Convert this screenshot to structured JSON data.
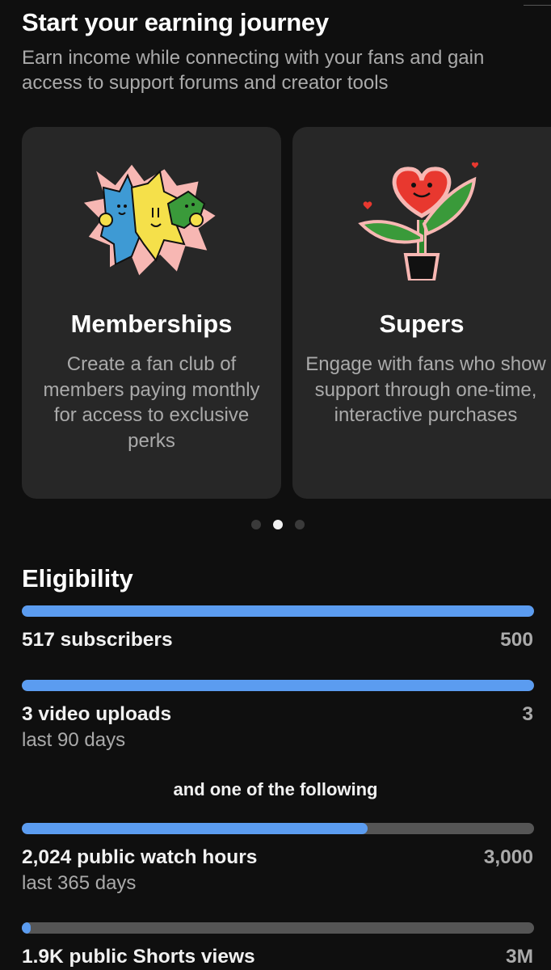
{
  "header": {
    "title": "Start your earning journey",
    "subtitle": "Earn income while connecting with your fans and gain access to support forums and creator tools"
  },
  "carousel": {
    "cards": [
      {
        "icon": "memberships-illustration-icon",
        "title": "Memberships",
        "description": "Create a fan club of members paying monthly for access to exclusive perks"
      },
      {
        "icon": "supers-flower-illustration-icon",
        "title": "Supers",
        "description": "Engage with fans who show support through one-time, interactive purchases"
      }
    ],
    "page_count": 3,
    "active_page": 2
  },
  "eligibility": {
    "title": "Eligibility",
    "connector": "and one of the following",
    "requirements": [
      {
        "label": "517 subscribers",
        "target": "500",
        "sub": "",
        "progress": 1.0
      },
      {
        "label": "3 video uploads",
        "target": "3",
        "sub": "last 90 days",
        "progress": 1.0
      },
      {
        "label": "2,024 public watch hours",
        "target": "3,000",
        "sub": "last 365 days",
        "progress": 0.675
      },
      {
        "label": "1.9K public Shorts views",
        "target": "3M",
        "sub": "",
        "progress": 0.012
      }
    ]
  },
  "colors": {
    "background": "#0f0f0f",
    "card": "#272727",
    "progress_fill": "#5b9cf0",
    "progress_track": "#555555",
    "secondary_text": "#aaaaaa"
  }
}
